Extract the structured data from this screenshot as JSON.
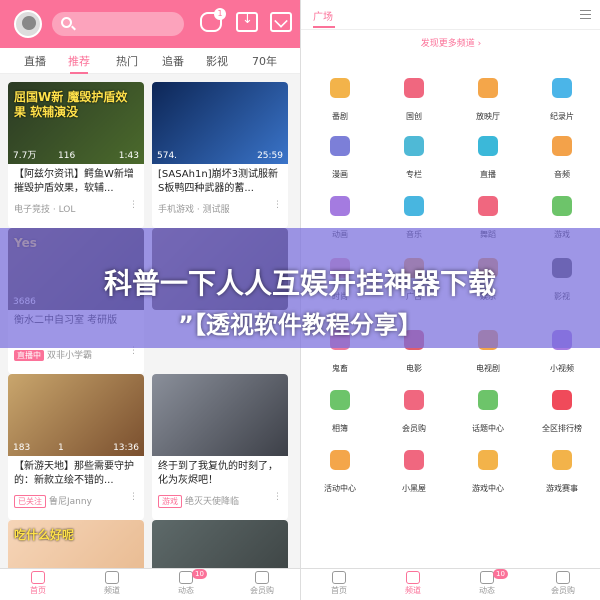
{
  "left_app": {
    "header": {
      "notification_count": "1"
    },
    "tabs": [
      "直播",
      "推荐",
      "热门",
      "追番",
      "影视",
      "70年"
    ],
    "active_tab": "推荐",
    "cards": [
      {
        "thumb_text": "屈国W新 魔毁护盾效果 软辅演没",
        "views": "7.7万",
        "comments": "116",
        "duration": "1:43",
        "title": "【阿兹尔资讯】鳄鱼W新增摧毁护盾效果，软辅...",
        "tag": "",
        "channel": "电子竞技 · LOL",
        "thumb_colors": [
          "#2b3a24",
          "#4b6a2c"
        ]
      },
      {
        "thumb_text": "",
        "views": "574.",
        "comments": "",
        "duration": "25:59",
        "title": "[SASAh1n]崩坏3测试服新S板鸭四种武器的蓄...",
        "tag": "",
        "channel": "手机游戏 · 测试服",
        "thumb_colors": [
          "#0d2656",
          "#3a74c9"
        ]
      },
      {
        "thumb_text": "Yes",
        "views": "3686",
        "comments": "",
        "duration": "",
        "title": "衡水二中自习室 考研版",
        "tag": "直播中",
        "channel": "双非小学霸",
        "thumb_colors": [
          "#5b4a3a",
          "#2e2a26"
        ]
      },
      {
        "thumb_text": "",
        "views": "",
        "comments": "",
        "duration": "",
        "title": "",
        "tag": "",
        "channel": "",
        "thumb_colors": [
          "#6a5a52",
          "#3a3430"
        ]
      },
      {
        "thumb_text": "",
        "views": "183",
        "comments": "1",
        "duration": "13:36",
        "title": "【新游天地】那些需要守护的：新款立绘不错的...",
        "tag": "已关注",
        "channel": "鲁尼Janny",
        "thumb_colors": [
          "#c9a66d",
          "#7a4f2e"
        ]
      },
      {
        "thumb_text": "",
        "views": "",
        "comments": "",
        "duration": "",
        "title": "终于到了我复仇的时刻了，化为灰烬吧！",
        "tag": "游戏",
        "channel": "绝灭天使降临",
        "thumb_colors": [
          "#8a8f9a",
          "#3d4048"
        ]
      },
      {
        "thumb_text": "吃什么好呢",
        "views": "",
        "comments": "",
        "duration": "",
        "title": "",
        "tag": "",
        "channel": "",
        "thumb_colors": [
          "#f6d5b8",
          "#e7b88d"
        ]
      },
      {
        "thumb_text": "",
        "views": "",
        "comments": "",
        "duration": "",
        "title": "",
        "tag": "",
        "channel": "",
        "thumb_colors": [
          "#5e6a6a",
          "#3a4040"
        ]
      }
    ],
    "bottom_nav": [
      {
        "label": "首页",
        "badge": ""
      },
      {
        "label": "频道",
        "badge": ""
      },
      {
        "label": "动态",
        "badge": "10"
      },
      {
        "label": "会员购",
        "badge": ""
      }
    ]
  },
  "right_app": {
    "header_title": "广场",
    "discover_link": "发现更多频道 ›",
    "categories": [
      {
        "label": "番剧",
        "icon": "tv-icon",
        "color": "#f3b34a"
      },
      {
        "label": "国创",
        "icon": "peach-icon",
        "color": "#f0677f"
      },
      {
        "label": "放映厅",
        "icon": "film-reel-icon",
        "color": "#f4a64a"
      },
      {
        "label": "纪录片",
        "icon": "kite-icon",
        "color": "#4bb5e8"
      },
      {
        "label": "漫画",
        "icon": "hat-icon",
        "color": "#7c7fd8"
      },
      {
        "label": "专栏",
        "icon": "document-icon",
        "color": "#4fb9d6"
      },
      {
        "label": "直播",
        "icon": "camera-icon",
        "color": "#3bb8d9"
      },
      {
        "label": "音频",
        "icon": "music-icon",
        "color": "#f3a24a"
      },
      {
        "label": "动画",
        "icon": "play-icon",
        "color": "#a47be0"
      },
      {
        "label": "音乐",
        "icon": "headphones-icon",
        "color": "#48b6e0"
      },
      {
        "label": "舞蹈",
        "icon": "fan-icon",
        "color": "#f0677f"
      },
      {
        "label": "游戏",
        "icon": "creeper-icon",
        "color": "#6dc46a"
      },
      {
        "label": "时尚",
        "icon": "fashion-icon",
        "color": "#f0a2b8"
      },
      {
        "label": "广告",
        "icon": "ad-icon",
        "color": "#f4a64a"
      },
      {
        "label": "娱乐",
        "icon": "star-icon",
        "color": "#f0a14a"
      },
      {
        "label": "影视",
        "icon": "clapper-icon",
        "color": "#4b4b4b"
      },
      {
        "label": "鬼畜",
        "icon": "ghost-icon",
        "color": "#f07a9a"
      },
      {
        "label": "电影",
        "icon": "3d-glasses-icon",
        "color": "#e25d6b"
      },
      {
        "label": "电视剧",
        "icon": "tv-set-icon",
        "color": "#f4a64a"
      },
      {
        "label": "小视频",
        "icon": "video-icon",
        "color": "#a77be0"
      },
      {
        "label": "相簿",
        "icon": "photo-icon",
        "color": "#6dc46a"
      },
      {
        "label": "会员购",
        "icon": "shopping-bag-icon",
        "color": "#f0677f"
      },
      {
        "label": "话题中心",
        "icon": "chat-icon",
        "color": "#6dc46a"
      },
      {
        "label": "全区排行榜",
        "icon": "trophy-icon",
        "color": "#f04a5a"
      },
      {
        "label": "活动中心",
        "icon": "flag-icon",
        "color": "#f4a64a"
      },
      {
        "label": "小黑屋",
        "icon": "ban-icon",
        "color": "#f0677f"
      },
      {
        "label": "游戏中心",
        "icon": "gamepad-icon",
        "color": "#f3b34a"
      },
      {
        "label": "游戏赛事",
        "icon": "cup-icon",
        "color": "#f3b34a"
      }
    ],
    "bottom_nav": [
      {
        "label": "首页",
        "badge": ""
      },
      {
        "label": "频道",
        "badge": ""
      },
      {
        "label": "动态",
        "badge": "10"
      },
      {
        "label": "会员购",
        "badge": ""
      }
    ]
  },
  "overlay": {
    "line1": "科普一下人人互娱开挂神器下载",
    "line2": "”【透视软件教程分享】"
  },
  "colors": {
    "accent": "#fb7299",
    "overlay": "#786edc"
  }
}
